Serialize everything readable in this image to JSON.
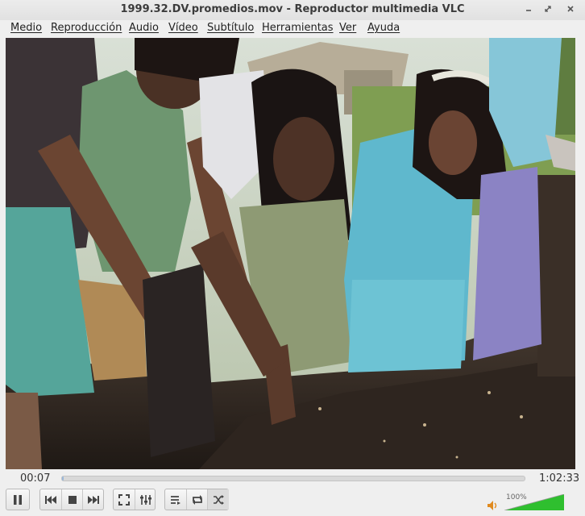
{
  "window": {
    "title": "1999.32.DV.promedios.mov - Reproductor multimedia VLC"
  },
  "menu": [
    {
      "label": "Medio"
    },
    {
      "label": "Reproducción"
    },
    {
      "label": "Audio"
    },
    {
      "label": "Vídeo"
    },
    {
      "label": "Subtítulo"
    },
    {
      "label": "Herramientas"
    },
    {
      "label": "Ver"
    },
    {
      "label": "Ayuda"
    }
  ],
  "video": {
    "description_icon": "video-frame"
  },
  "playback": {
    "elapsed": "00:07",
    "total": "1:02:33",
    "progress": 0.0019
  },
  "controls": {
    "play_state": "playing",
    "buttons": [
      "pause-icon",
      "previous-icon",
      "stop-icon",
      "next-icon",
      "fullscreen-icon",
      "extended-settings-icon",
      "playlist-icon",
      "loop-icon",
      "shuffle-icon"
    ]
  },
  "volume": {
    "label": "100%",
    "level": 1.0,
    "accent": "#2fbf2f"
  }
}
